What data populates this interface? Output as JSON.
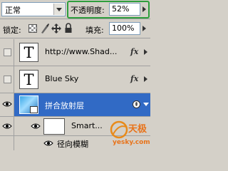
{
  "blend_mode": {
    "value": "正常"
  },
  "opacity": {
    "label": "不透明度:",
    "value": "52%"
  },
  "lock": {
    "label": "锁定:"
  },
  "fill": {
    "label": "填充:",
    "value": "100%"
  },
  "layers": [
    {
      "name": "http://www.Shad...",
      "thumbnail_glyph": "T",
      "fx": "fx"
    },
    {
      "name": "Blue Sky",
      "thumbnail_glyph": "T",
      "fx": "fx"
    },
    {
      "name": "拼合放射层",
      "selected": true
    },
    {
      "name": "Smart..."
    },
    {
      "name": "径向模糊"
    }
  ],
  "watermark": {
    "text": "天极",
    "subtext": "yesky.com"
  },
  "colors": {
    "selected_row": "#316ac5",
    "panel_bg": "#d4d0c8",
    "highlight_border": "#2e9e3c"
  }
}
